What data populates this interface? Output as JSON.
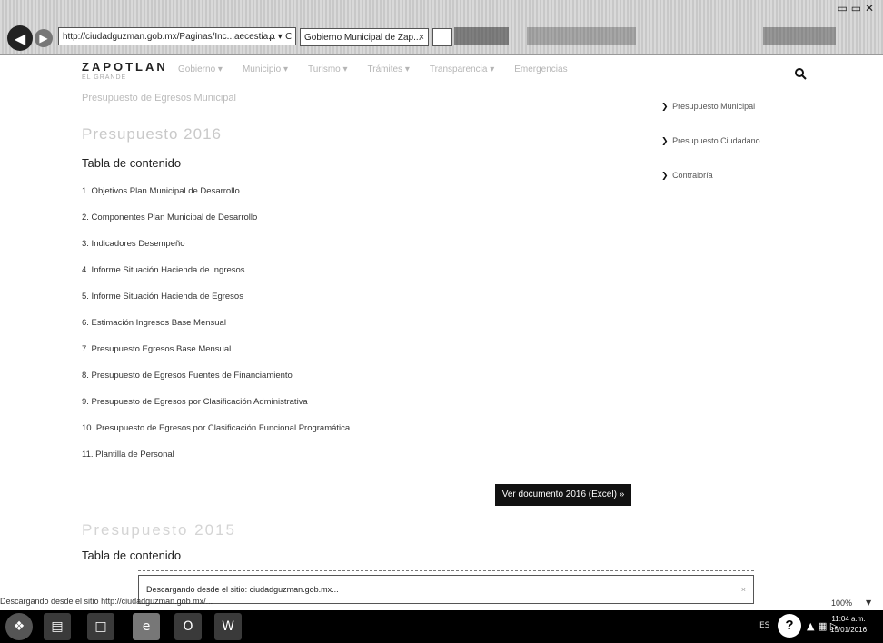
{
  "browser": {
    "address": "http://ciudadguzman.gob.mx/Paginas/Inc...aecestia...",
    "address_controls": "ρ ▾ C",
    "tab_title": "Gobierno Municipal de Zap...",
    "tab_close": "×",
    "window_controls": "▭ ▭ ✕"
  },
  "site": {
    "logo": "ZAPOTLAN",
    "logo_sub": "EL GRANDE",
    "menu": [
      "Gobierno ▾",
      "Municipio ▾",
      "Turismo ▾",
      "Trámites ▾",
      "Transparencia ▾",
      "Emergencias"
    ]
  },
  "main": {
    "breadcrumb": "Presupuesto de Egresos Municipal",
    "heading_2016": "Presupuesto 2016",
    "toc_title": "Tabla de contenido",
    "toc_items": [
      "1. Objetivos Plan Municipal de Desarrollo",
      "2. Componentes Plan Municipal de Desarrollo",
      "3. Indicadores Desempeño",
      "4. Informe Situación Hacienda de Ingresos",
      "5. Informe Situación Hacienda de Egresos",
      "6. Estimación Ingresos Base Mensual",
      "7. Presupuesto Egresos Base Mensual",
      "8. Presupuesto de Egresos Fuentes de Financiamiento",
      "9. Presupuesto de Egresos por Clasificación Administrativa",
      "10. Presupuesto de Egresos por Clasificación Funcional Programática",
      "11. Plantilla de Personal"
    ],
    "doc_button": "Ver documento 2016 (Excel) »",
    "heading_2015": "Presupuesto 2015",
    "toc_title_2": "Tabla de contenido"
  },
  "sidebar": {
    "items": [
      "Presupuesto Municipal",
      "Presupuesto Ciudadano",
      "Contraloría"
    ]
  },
  "notification": {
    "text": "Descargando desde el sitio: ciudadguzman.gob.mx...",
    "close": "×"
  },
  "status": {
    "text": "Descargando desde el sitio http://ciudadguzman.gob.mx/...",
    "zoom": "100%"
  },
  "taskbar": {
    "lang": "ES",
    "time": "11:04 a.m.",
    "date": "15/01/2016"
  }
}
